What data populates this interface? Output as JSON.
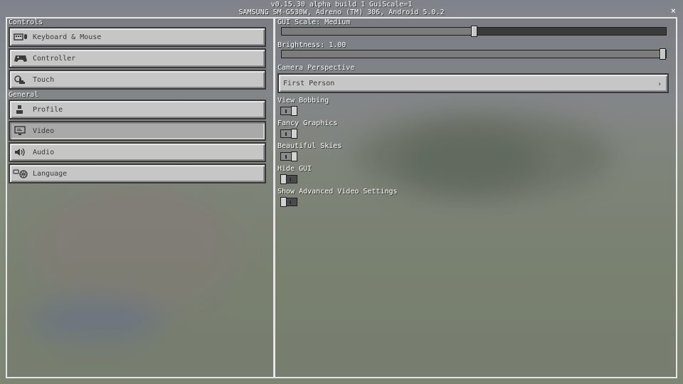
{
  "header": {
    "version_line": "v0.15.30 alpha build 1 GuiScale=1",
    "device_line": "SAMSUNG SM-G530W, Adreno (TM) 306, Android 5.0.2",
    "close_glyph": "×"
  },
  "sidebar": {
    "controls_label": "Controls",
    "general_label": "General",
    "controls": [
      {
        "label": "Keyboard & Mouse",
        "icon": "keyboard-mouse-icon"
      },
      {
        "label": "Controller",
        "icon": "gamepad-icon"
      },
      {
        "label": "Touch",
        "icon": "touch-hand-icon"
      }
    ],
    "general": [
      {
        "label": "Profile",
        "icon": "profile-icon"
      },
      {
        "label": "Video",
        "icon": "monitor-icon",
        "selected": true
      },
      {
        "label": "Audio",
        "icon": "speaker-icon"
      },
      {
        "label": "Language",
        "icon": "globe-icon"
      }
    ]
  },
  "video": {
    "gui_scale": {
      "label": "GUI Scale: Medium",
      "level": 0.5
    },
    "brightness": {
      "label": "Brightness: 1.00",
      "level": 1.0
    },
    "camera_perspective": {
      "label": "Camera Perspective",
      "value": "First Person",
      "arrow": "›"
    },
    "toggles": [
      {
        "label": "View Bobbing",
        "on": true
      },
      {
        "label": "Fancy Graphics",
        "on": true
      },
      {
        "label": "Beautiful Skies",
        "on": true
      },
      {
        "label": "Hide GUI",
        "on": false
      },
      {
        "label": "Show Advanced Video Settings",
        "on": false
      }
    ]
  },
  "colors": {
    "button_face": "#c6c6c6",
    "button_selected": "#a9a9a9",
    "slider_track": "#3b3b3b",
    "panel_border": "#e6e6e6"
  }
}
